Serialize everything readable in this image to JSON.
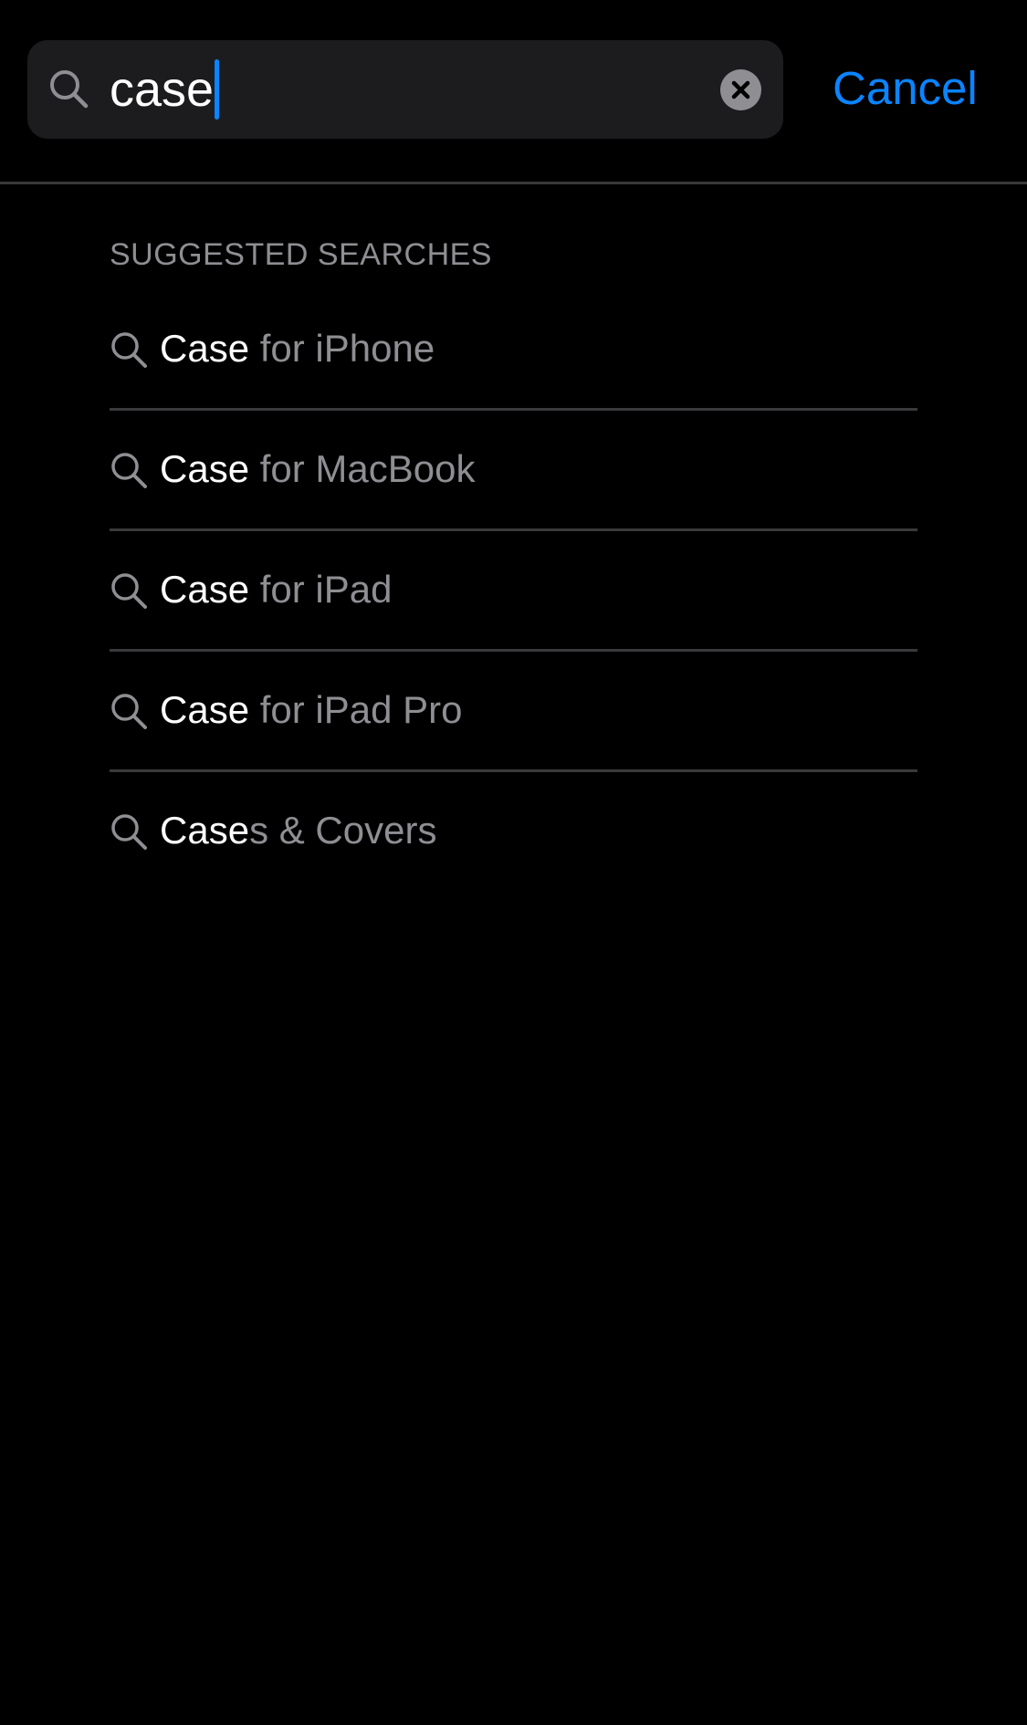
{
  "search": {
    "query": "case",
    "clear_label": "×",
    "cancel_label": "Cancel"
  },
  "suggestions": {
    "title": "SUGGESTED SEARCHES",
    "items": [
      {
        "match": "Case",
        "rest": " for iPhone"
      },
      {
        "match": "Case",
        "rest": " for MacBook"
      },
      {
        "match": "Case",
        "rest": " for iPad"
      },
      {
        "match": "Case",
        "rest": " for iPad Pro"
      },
      {
        "match": "Case",
        "rest": "s & Covers"
      }
    ]
  },
  "icons": {
    "search_field": "search-icon",
    "clear": "clear-icon",
    "suggestion": "search-icon"
  },
  "colors": {
    "background": "#000000",
    "field": "#1c1c1e",
    "accent": "#0a84ff",
    "secondary_text": "#8e8e93",
    "divider": "#3a3a3c"
  }
}
